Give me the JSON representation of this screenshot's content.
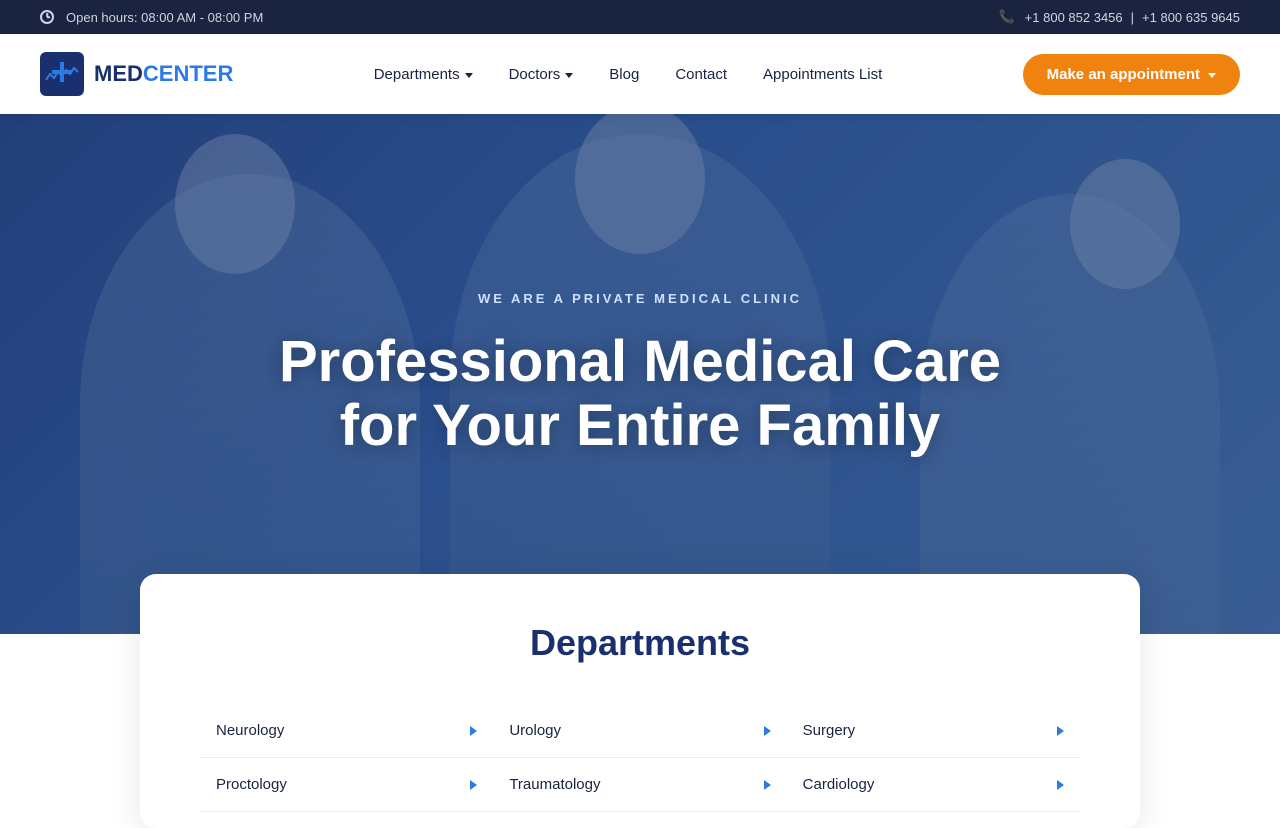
{
  "topbar": {
    "hours_label": "Open hours: 08:00 AM - 08:00 PM",
    "phone1": "+1 800 852 3456",
    "phone_separator": "|",
    "phone2": "+1 800 635 9645"
  },
  "navbar": {
    "logo_med": "MED",
    "logo_center": "CENTER",
    "nav_items": [
      {
        "label": "Departments",
        "has_dropdown": true
      },
      {
        "label": "Doctors",
        "has_dropdown": true
      },
      {
        "label": "Blog",
        "has_dropdown": false
      },
      {
        "label": "Contact",
        "has_dropdown": false
      },
      {
        "label": "Appointments List",
        "has_dropdown": false
      }
    ],
    "cta_button": "Make an appointment"
  },
  "hero": {
    "subtitle": "WE ARE A PRIVATE MEDICAL CLINIC",
    "title_line1": "Professional Medical Care",
    "title_line2": "for Your Entire Family"
  },
  "departments": {
    "section_title": "Departments",
    "items": [
      {
        "name": "Neurology"
      },
      {
        "name": "Urology"
      },
      {
        "name": "Surgery"
      },
      {
        "name": "Proctology"
      },
      {
        "name": "Traumatology"
      },
      {
        "name": "Cardiology"
      }
    ]
  }
}
